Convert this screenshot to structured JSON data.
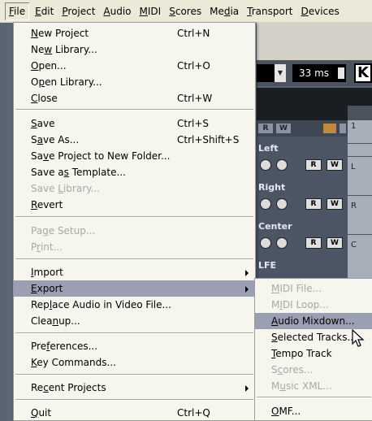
{
  "menubar": {
    "items": [
      "File",
      "Edit",
      "Project",
      "Audio",
      "MIDI",
      "Scores",
      "Media",
      "Transport",
      "Devices"
    ]
  },
  "file_menu": {
    "new_project": {
      "label": "New Project",
      "shortcut": "Ctrl+N"
    },
    "new_library": {
      "label": "New Library..."
    },
    "open": {
      "label": "Open...",
      "shortcut": "Ctrl+O"
    },
    "open_library": {
      "label": "Open Library..."
    },
    "close": {
      "label": "Close",
      "shortcut": "Ctrl+W"
    },
    "save": {
      "label": "Save",
      "shortcut": "Ctrl+S"
    },
    "save_as": {
      "label": "Save As...",
      "shortcut": "Ctrl+Shift+S"
    },
    "save_project_folder": {
      "label": "Save Project to New Folder..."
    },
    "save_as_template": {
      "label": "Save as Template..."
    },
    "save_library": {
      "label": "Save Library..."
    },
    "revert": {
      "label": "Revert"
    },
    "page_setup": {
      "label": "Page Setup..."
    },
    "print": {
      "label": "Print..."
    },
    "import": {
      "label": "Import"
    },
    "export": {
      "label": "Export"
    },
    "replace_audio": {
      "label": "Replace Audio in Video File..."
    },
    "cleanup": {
      "label": "Cleanup..."
    },
    "preferences": {
      "label": "Preferences..."
    },
    "key_commands": {
      "label": "Key Commands..."
    },
    "recent_projects": {
      "label": "Recent Projects"
    },
    "quit": {
      "label": "Quit",
      "shortcut": "Ctrl+Q"
    }
  },
  "export_submenu": {
    "midi_file": "MIDI File...",
    "midi_loop": "MIDI Loop...",
    "audio_mixdown": "Audio Mixdown...",
    "selected_tracks": "Selected Tracks...",
    "tempo_track": "Tempo Track",
    "scores": "Scores...",
    "music_xml": "Music XML...",
    "omf": "OMF..."
  },
  "background": {
    "toolbar_ms": "33 ms",
    "toolbar_k": "K",
    "channels": [
      "Left",
      "Right",
      "Center",
      "LFE"
    ],
    "read_label": "R",
    "write_label": "W",
    "header_boxes": [
      "R",
      "W"
    ],
    "ruler_marks": [
      "1",
      "L",
      "R",
      "C"
    ]
  },
  "colors": {
    "menu_bg": "#f6f5ee",
    "highlight": "#9b9fb4",
    "menubar_bg": "#ece9d8",
    "disabled_text": "#a8a8a8"
  }
}
